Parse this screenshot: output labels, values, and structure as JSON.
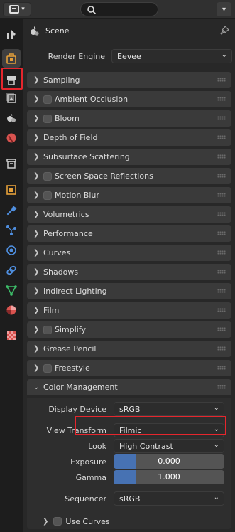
{
  "context": {
    "label": "Scene"
  },
  "render_engine": {
    "label": "Render Engine",
    "value": "Eevee"
  },
  "panels": [
    {
      "title": "Sampling",
      "checkbox": false,
      "expanded": false
    },
    {
      "title": "Ambient Occlusion",
      "checkbox": true,
      "expanded": false
    },
    {
      "title": "Bloom",
      "checkbox": true,
      "expanded": false
    },
    {
      "title": "Depth of Field",
      "checkbox": false,
      "expanded": false
    },
    {
      "title": "Subsurface Scattering",
      "checkbox": false,
      "expanded": false
    },
    {
      "title": "Screen Space Reflections",
      "checkbox": true,
      "expanded": false
    },
    {
      "title": "Motion Blur",
      "checkbox": true,
      "expanded": false
    },
    {
      "title": "Volumetrics",
      "checkbox": false,
      "expanded": false
    },
    {
      "title": "Performance",
      "checkbox": false,
      "expanded": false
    },
    {
      "title": "Curves",
      "checkbox": false,
      "expanded": false
    },
    {
      "title": "Shadows",
      "checkbox": false,
      "expanded": false
    },
    {
      "title": "Indirect Lighting",
      "checkbox": false,
      "expanded": false
    },
    {
      "title": "Film",
      "checkbox": false,
      "expanded": false
    },
    {
      "title": "Simplify",
      "checkbox": true,
      "expanded": false
    },
    {
      "title": "Grease Pencil",
      "checkbox": false,
      "expanded": false
    },
    {
      "title": "Freestyle",
      "checkbox": true,
      "expanded": false
    },
    {
      "title": "Color Management",
      "checkbox": false,
      "expanded": true
    }
  ],
  "color_management": {
    "display_device": {
      "label": "Display Device",
      "value": "sRGB"
    },
    "view_transform": {
      "label": "View Transform",
      "value": "Filmic"
    },
    "look": {
      "label": "Look",
      "value": "High Contrast"
    },
    "exposure": {
      "label": "Exposure",
      "value": "0.000",
      "fill_fraction": 0.2
    },
    "gamma": {
      "label": "Gamma",
      "value": "1.000",
      "fill_fraction": 0.2
    },
    "sequencer": {
      "label": "Sequencer",
      "value": "sRGB"
    },
    "use_curves": {
      "label": "Use Curves"
    }
  },
  "colors": {
    "accent": "#4772b3",
    "highlight": "#e6262d",
    "active_tab_icon": "#e5a03a"
  },
  "tabs": [
    "tool-icon",
    "render-properties-icon",
    "output-properties-icon",
    "view-layer-icon",
    "scene-icon",
    "world-icon",
    "collection-icon",
    "object-icon",
    "modifier-icon",
    "particles-icon",
    "physics-icon",
    "constraints-icon",
    "object-data-icon",
    "material-icon",
    "texture-icon"
  ]
}
